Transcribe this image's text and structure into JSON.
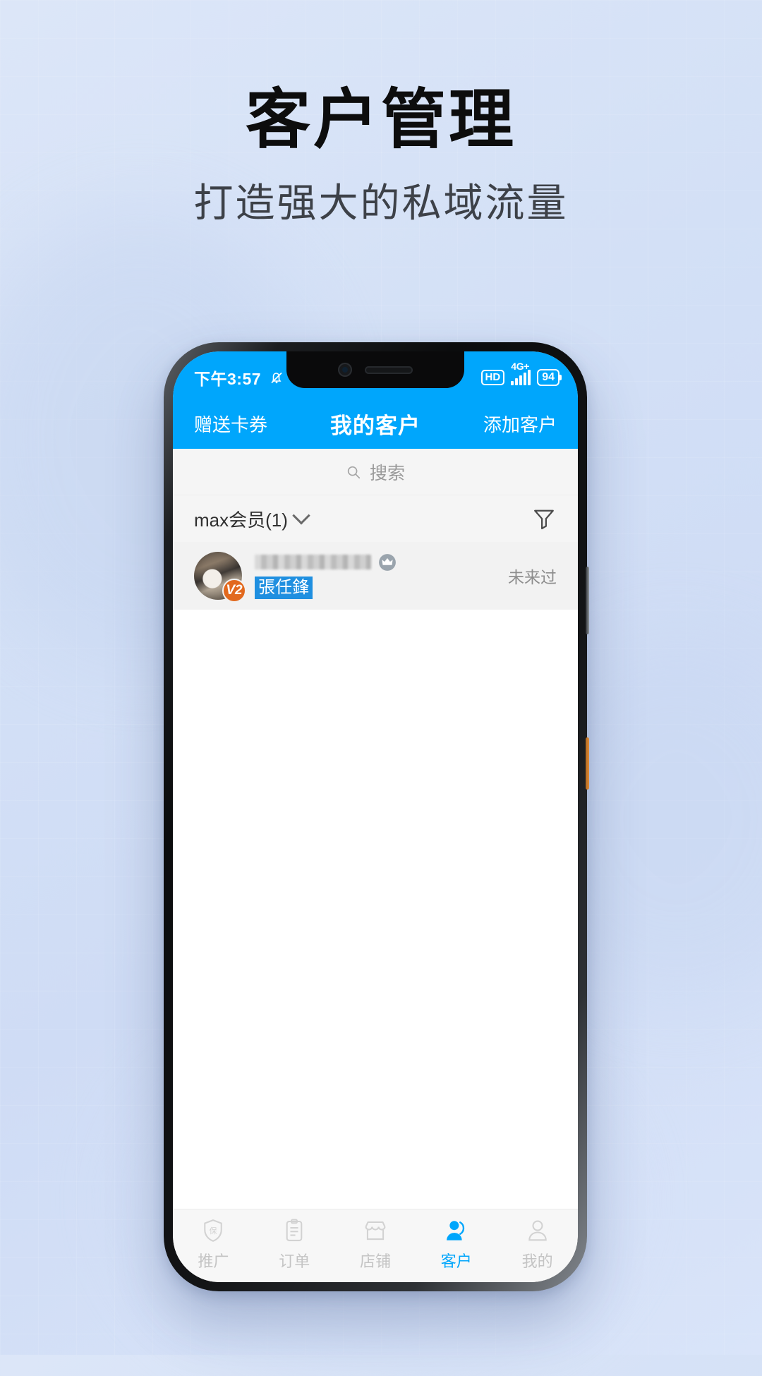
{
  "poster": {
    "title": "客户管理",
    "subtitle": "打造强大的私域流量"
  },
  "colors": {
    "accent": "#00A6FC",
    "tag_blue": "#1F8FE0",
    "badge_orange": "#E2691E",
    "background": "#D3E0F6"
  },
  "phone": {
    "statusbar": {
      "time": "下午3:57",
      "mute_icon": "bell-muted-icon",
      "hd_label": "HD",
      "network_label": "4G+",
      "battery_level": "94"
    },
    "appbar": {
      "left_action": "赠送卡券",
      "title": "我的客户",
      "right_action": "添加客户"
    },
    "search": {
      "icon": "search-icon",
      "placeholder": "搜索",
      "value": ""
    },
    "filter": {
      "group_label": "max会员(1)",
      "dropdown_icon": "chevron-down-icon",
      "funnel_icon": "filter-funnel-icon"
    },
    "customers": [
      {
        "avatar": "customer-avatar",
        "level_badge": "V2",
        "name_masked": "",
        "crown_icon": "crown-icon",
        "tag": "張任鋒",
        "status": "未来过"
      }
    ],
    "tabs": [
      {
        "label": "推广",
        "icon": "shield-promo-icon",
        "active": false
      },
      {
        "label": "订单",
        "icon": "clipboard-order-icon",
        "active": false
      },
      {
        "label": "店铺",
        "icon": "store-icon",
        "active": false
      },
      {
        "label": "客户",
        "icon": "customer-person-icon",
        "active": true
      },
      {
        "label": "我的",
        "icon": "profile-person-icon",
        "active": false
      }
    ]
  }
}
